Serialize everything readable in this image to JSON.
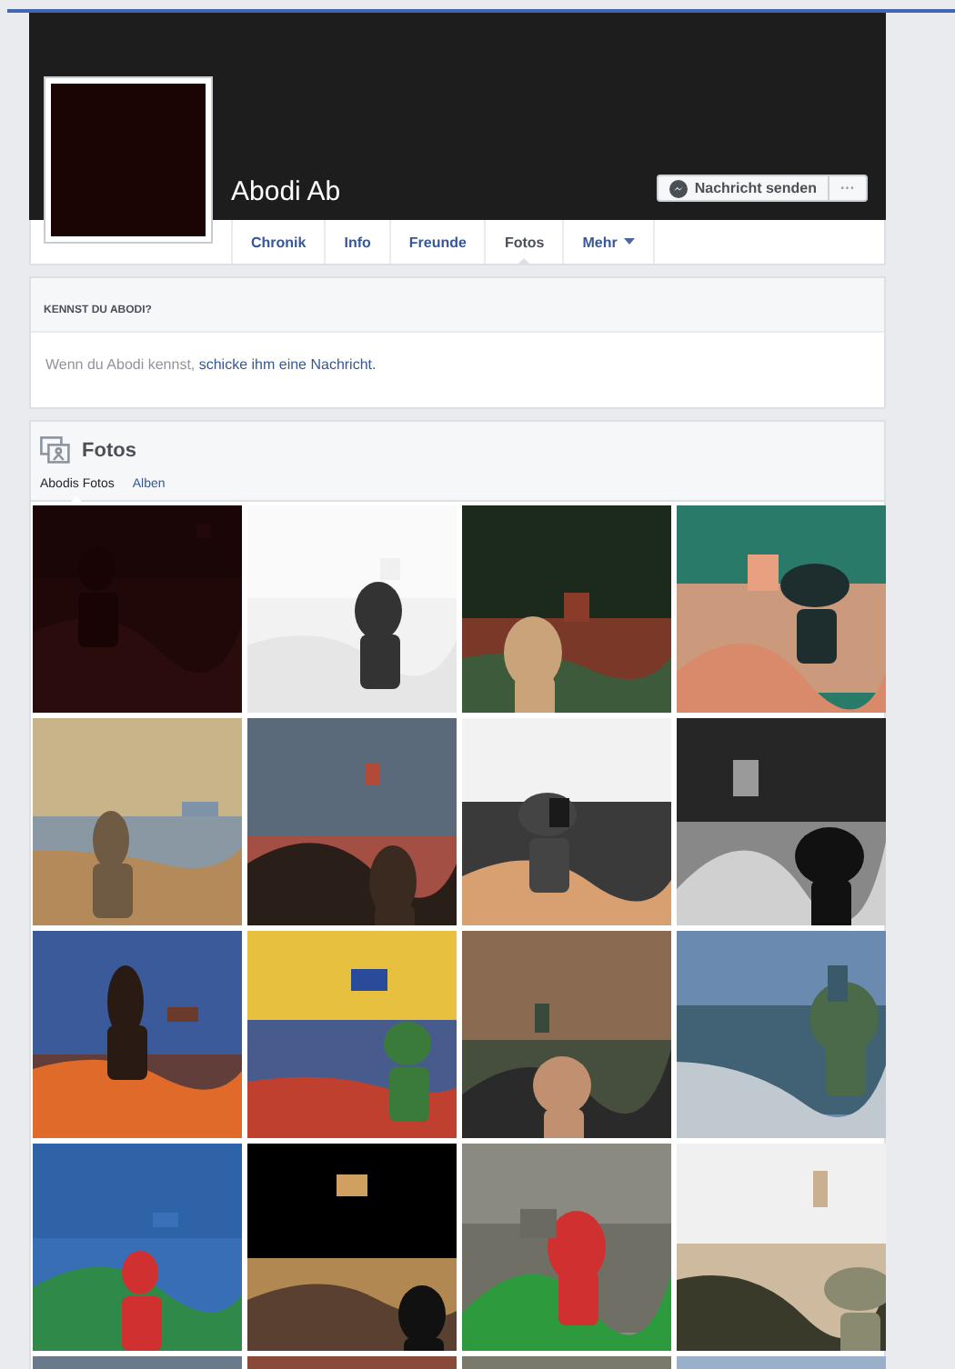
{
  "profile": {
    "name": "Abodi Ab",
    "message_button": "Nachricht senden",
    "more_button": "···"
  },
  "tabs": [
    {
      "label": "Chronik",
      "selected": false,
      "kind": "link"
    },
    {
      "label": "Info",
      "selected": false,
      "kind": "link"
    },
    {
      "label": "Freunde",
      "selected": false,
      "kind": "link"
    },
    {
      "label": "Fotos",
      "selected": true,
      "kind": "link"
    },
    {
      "label": "Mehr",
      "selected": false,
      "kind": "dropdown"
    }
  ],
  "know_card": {
    "title": "KENNST DU ABODI?",
    "text": "Wenn du Abodi kennst,",
    "link": "schicke ihm eine Nachricht."
  },
  "photos_card": {
    "title": "Fotos",
    "subtabs": [
      {
        "label": "Abodis Fotos",
        "selected": true
      },
      {
        "label": "Alben",
        "selected": false
      }
    ]
  }
}
